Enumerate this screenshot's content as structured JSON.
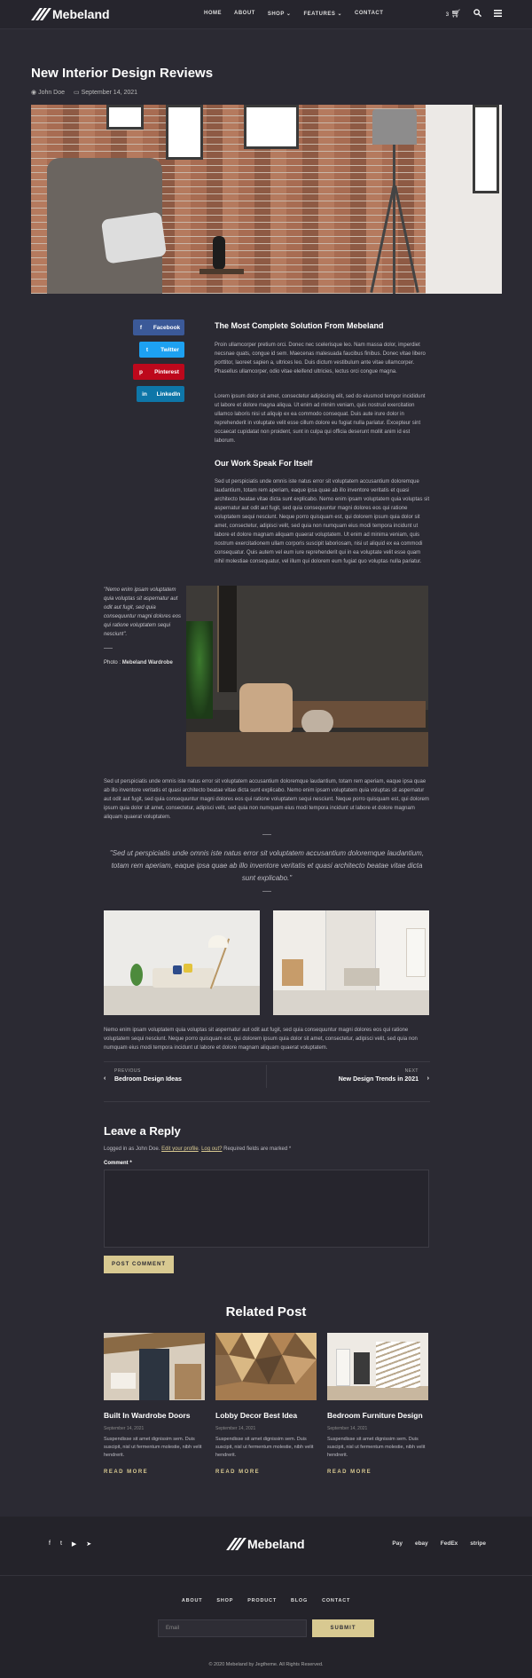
{
  "header": {
    "logo": "Mebeland",
    "nav": [
      "HOME",
      "ABOUT",
      "SHOP ⌄",
      "FEATURES ⌄",
      "CONTACT"
    ],
    "cart_count": "3"
  },
  "post": {
    "title": "New Interior Design Reviews",
    "author": "John Doe",
    "date": "September 14, 2021"
  },
  "share": [
    {
      "label": "Facebook",
      "icon": "f",
      "color": "#3b5998"
    },
    {
      "label": "Twitter",
      "icon": "t",
      "color": "#1da1f2"
    },
    {
      "label": "Pinterest",
      "icon": "p",
      "color": "#bd081c"
    },
    {
      "label": "LinkedIn",
      "icon": "in",
      "color": "#0e76a8"
    }
  ],
  "section1": {
    "heading": "The Most Complete Solution From Mebeland",
    "p1": "Proin ullamcorper pretium orci. Donec nec scelerisque leo. Nam massa dolor, imperdiet necsnae quats, congue id sem. Maecenas malesuada faucibus finibus. Donec vitae libero porttitor, laoreet sapien a, ultrices leo. Duis dictum vestibulum ante vitae ullamcorper. Phasellus ullamcorper, odio vitae eleifend ultricies, lectus orci congue magna.",
    "p2": "Lorem ipsum dolor sit amet, consectetur adipiscing elit, sed do eiusmod tempor incididunt ut labore et dolore magna aliqua. Ut enim ad minim veniam, quis nostrud exercitation ullamco laboris nisi ut aliquip ex ea commodo consequat. Duis aute irure dolor in reprehenderit in voluptate velit esse cillum dolore eu fugiat nulla pariatur. Excepteur sint occaecat cupidatat non proident, sunt in culpa qui officia deserunt mollit anim id est laborum."
  },
  "section2": {
    "heading": "Our Work Speak For Itself",
    "p1": "Sed ut perspiciatis unde omnis iste natus error sit voluptatem accusantium doloremque laudantium, totam rem aperiam, eaque ipsa quae ab illo inventore veritatis et quasi architecto beatae vitae dicta sunt explicabo. Nemo enim ipsam voluptatem quia voluptas sit aspernatur aut odit aut fugit, sed quia consequuntur magni dolores eos qui ratione voluptatem sequi nesciunt. Neque porro quisquam est, qui dolorem ipsum quia dolor sit amet, consectetur, adipisci velit, sed quia non numquam eius modi tempora incidunt ut labore et dolore magnam aliquam quaerat voluptatem. Ut enim ad minima veniam, quis nostrum exercitationem ullam corporis suscipit laboriosam, nisi ut aliquid ex ea commodi consequatur. Quis autem vel eum iure reprehenderit qui in ea voluptate velit esse quam nihil molestiae consequatur, vel illum qui dolorem eum fugiat quo voluptas nulla pariatur."
  },
  "side_quote": {
    "text": "\"Nemo enim ipsam voluptatem quia voluptas sit aspernatur aut odit aut fugit, sed quia consequuntur magni dolores eos qui ratione voluptatem sequi nesciunt\".",
    "caption_prefix": "Photo : ",
    "caption_name": "Mebeland Wardrobe"
  },
  "para3": "Sed ut perspiciatis unde omnis iste natus error sit voluptatem accusantium doloremque laudantium, totam rem aperiam, eaque ipsa quae ab illo inventore veritatis et quasi architecto beatae vitae dicta sunt explicabo. Nemo enim ipsam voluptatem quia voluptas sit aspernatur aut odit aut fugit, sed quia consequuntur magni dolores eos qui ratione voluptatem sequi nesciunt. Neque porro quisquam est, qui dolorem ipsum quia dolor sit amet, consectetur, adipisci velit, sed quia non numquam eius modi tempora incidunt ut labore et dolore magnam aliquam quaerat voluptatem.",
  "blockquote": "\"Sed ut perspiciatis unde omnis iste natus error sit voluptatem accusantium doloremque laudantium, totam rem aperiam, eaque ipsa quae ab illo inventore veritatis et quasi architecto beatae vitae dicta sunt explicabo.\"",
  "para4": "Nemo enim ipsam voluptatem quia voluptas sit aspernatur aut odit aut fugit, sed quia consequuntur magni dolores eos qui ratione voluptatem sequi nesciunt. Neque porro quisquam est, qui dolorem ipsum quia dolor sit amet, consectetur, adipisci velit, sed quia non numquam eius modi tempora incidunt ut labore et dolore magnam aliquam quaerat voluptatem.",
  "post_nav": {
    "prev_label": "PREVIOUS",
    "prev_title": "Bedroom Design Ideas",
    "next_label": "NEXT",
    "next_title": "New Design Trends in 2021"
  },
  "reply": {
    "heading": "Leave a Reply",
    "logged_prefix": "Logged in as John Doe. ",
    "edit_link": "Edit your profile",
    "logout_link": "Log out?",
    "required": " Required fields are marked *",
    "comment_label": "Comment *",
    "submit": "POST COMMENT"
  },
  "related": {
    "heading": "Related Post",
    "cards": [
      {
        "title": "Built In Wardrobe Doors",
        "date": "September 14, 2021",
        "excerpt": "Suspendisse sit amet dignissim sem. Duis suscipit, nisl ut fermentum molestie, nibh velit hendrerit.",
        "more": "READ MORE"
      },
      {
        "title": "Lobby Decor Best Idea",
        "date": "September 14, 2021",
        "excerpt": "Suspendisse sit amet dignissim sem. Duis suscipit, nisl ut fermentum molestie, nibh velit hendrerit.",
        "more": "READ MORE"
      },
      {
        "title": "Bedroom Furniture Design",
        "date": "September 14, 2021",
        "excerpt": "Suspendisse sit amet dignissim sem. Duis suscipit, nisl ut fermentum molestie, nibh velit hendrerit.",
        "more": "READ MORE"
      }
    ]
  },
  "footer": {
    "logo": "Mebeland",
    "payments": [
      "Pay",
      "ebay",
      "FedEx",
      "stripe"
    ],
    "links": [
      "ABOUT",
      "SHOP",
      "PRODUCT",
      "BLOG",
      "CONTACT"
    ],
    "email_placeholder": "Email",
    "submit": "SUBMIT",
    "copyright": "© 2020 Mebeland by Jegtheme. All Rights Reserved."
  },
  "colors": {
    "background": "#2b2a33",
    "accent": "#d8c991"
  }
}
